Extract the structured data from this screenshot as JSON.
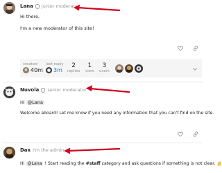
{
  "colors": {
    "accent": "#0088cc",
    "arrow": "#d0021b",
    "muted": "#919191",
    "heart": "#919191",
    "emoji": "#f2c94c"
  },
  "posts": [
    {
      "username": "Lana",
      "user_title": "junior moderator",
      "body": [
        "Hi there,",
        "I'm a new moderator of this site!"
      ],
      "topic_map": {
        "created_label": "created",
        "created_value": "40m",
        "last_reply_label": "last reply",
        "last_reply_value": "3m",
        "replies_count": "2",
        "replies_label": "replies",
        "views_count": "1",
        "views_label": "view",
        "users_count": "3",
        "users_label": "users"
      }
    },
    {
      "username": "Nuvola",
      "user_title": "senior moderator",
      "body_greeting": "Hi",
      "mention": "@Lana",
      "body_line2": "Welcome aboard! Let me know if you need any information that you can't find on the site."
    },
    {
      "username": "Dax",
      "user_title": "I'm the admin",
      "body_pre": "Hi",
      "mention": "@Lana",
      "body_mid": "! Start reading the",
      "hashtag": "#staff",
      "body_post": "category and ask questions if something is not clear."
    }
  ],
  "icons": {
    "shield": "shield-icon",
    "heart": "heart-icon",
    "link": "link-icon",
    "chevron": "chevron-down-icon",
    "emoji": "clapping-hands-emoji"
  }
}
